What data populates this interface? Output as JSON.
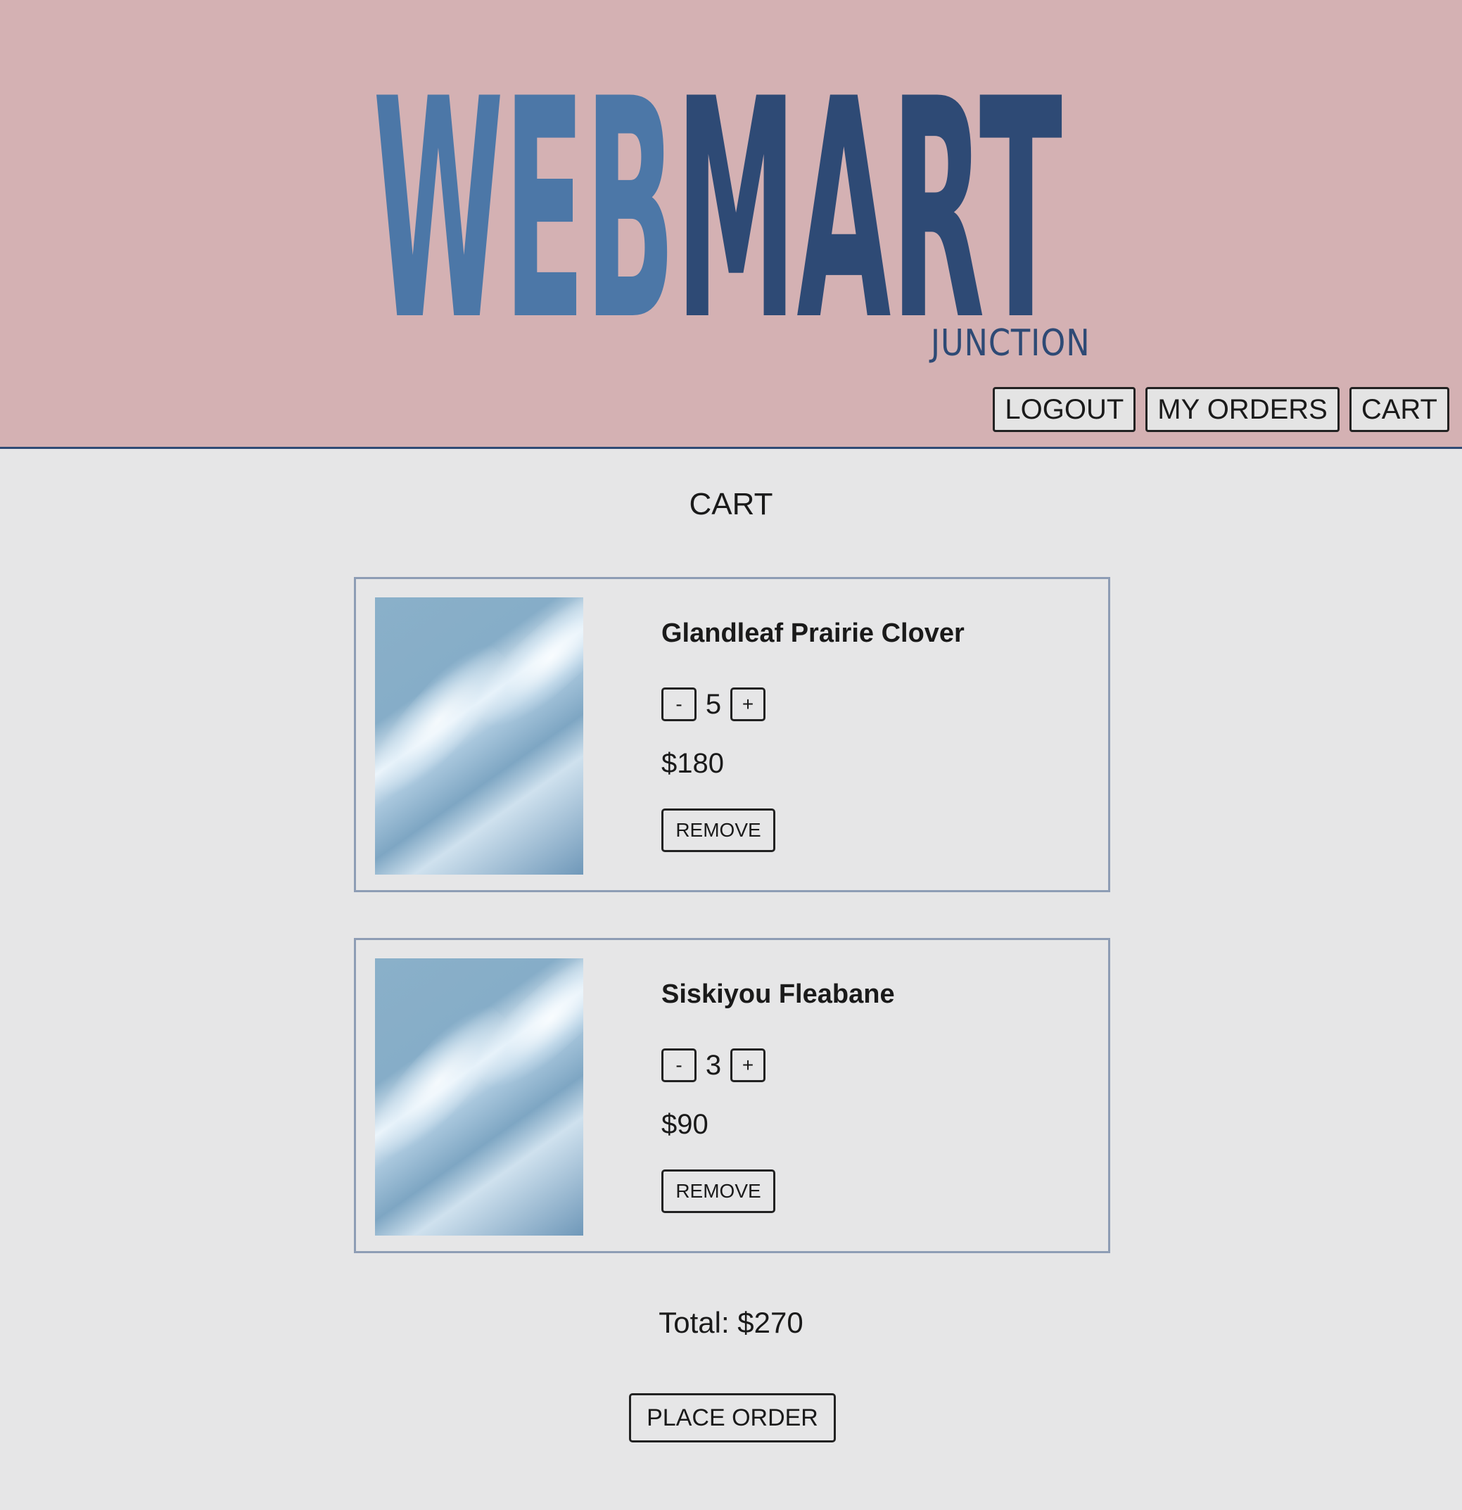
{
  "brand": {
    "logo_part1": "WEB",
    "logo_part2": "MART",
    "logo_sub": "JUNCTION",
    "colors": {
      "part1": "#4c77a7",
      "part2": "#2e4a75",
      "header_bg": "#d4b1b3"
    }
  },
  "nav": {
    "logout": "LOGOUT",
    "my_orders": "MY ORDERS",
    "cart": "CART"
  },
  "page": {
    "title": "CART"
  },
  "cart": {
    "items": [
      {
        "name": "Glandleaf Prairie Clover",
        "quantity": "5",
        "price": "$180",
        "remove_label": "REMOVE",
        "decrement": "-",
        "increment": "+"
      },
      {
        "name": "Siskiyou Fleabane",
        "quantity": "3",
        "price": "$90",
        "remove_label": "REMOVE",
        "decrement": "-",
        "increment": "+"
      }
    ],
    "total": "Total: $270",
    "place_order_label": "PLACE ORDER"
  }
}
